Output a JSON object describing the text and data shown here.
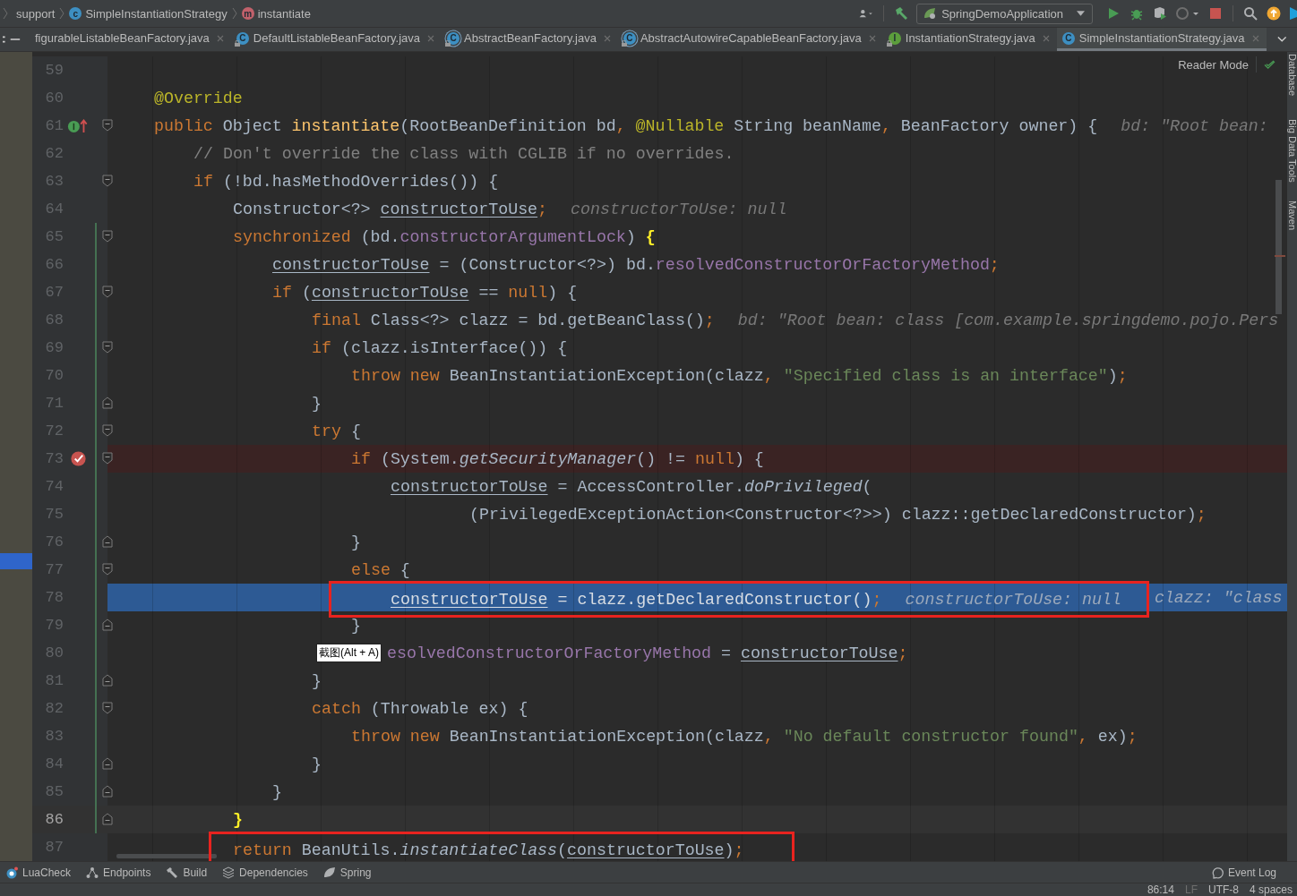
{
  "breadcrumbs": [
    {
      "label": "support"
    },
    {
      "label": "SimpleInstantiationStrategy",
      "badge": "c",
      "kind": "class"
    },
    {
      "label": "instantiate",
      "badge": "m",
      "kind": "method"
    }
  ],
  "run_config": {
    "label": "SpringDemoApplication"
  },
  "tabs": [
    {
      "label": "figurableListableBeanFactory.java",
      "locked": false,
      "selected": false
    },
    {
      "label": "DefaultListableBeanFactory.java",
      "badge": "C",
      "kind": "class",
      "locked": true,
      "selected": false
    },
    {
      "label": "AbstractBeanFactory.java",
      "badge": "C",
      "kind": "abstract",
      "locked": true,
      "selected": false
    },
    {
      "label": "AbstractAutowireCapableBeanFactory.java",
      "badge": "C",
      "kind": "abstract",
      "locked": true,
      "selected": false
    },
    {
      "label": "InstantiationStrategy.java",
      "badge": "I",
      "kind": "interface",
      "locked": true,
      "selected": false
    },
    {
      "label": "SimpleInstantiationStrategy.java",
      "badge": "C",
      "kind": "class",
      "locked": false,
      "selected": true
    }
  ],
  "editor": {
    "reader_mode": "Reader Mode",
    "lines": [
      {
        "number": "59",
        "kind": "normal",
        "changed": false
      },
      {
        "number": "60",
        "kind": "normal",
        "changed": false,
        "tokens": [
          {
            "kind": "annotation",
            "s": "@Override"
          }
        ]
      },
      {
        "number": "61",
        "kind": "normal",
        "changed": false,
        "marker": {
          "kind": "override"
        },
        "fold": {
          "kind": "start"
        },
        "tokens": [
          {
            "kind": "keyword",
            "s": "public "
          },
          {
            "kind": "plain",
            "s": "Object "
          },
          {
            "kind": "method",
            "s": "instantiate"
          },
          {
            "kind": "plain",
            "s": "(RootBeanDefinition bd"
          },
          {
            "kind": "keyword",
            "s": ", "
          },
          {
            "kind": "annotation",
            "s": "@Nullable"
          },
          {
            "kind": "plain",
            "s": " String beanName"
          },
          {
            "kind": "keyword",
            "s": ", "
          },
          {
            "kind": "plain",
            "s": "BeanFactory owner) {"
          },
          {
            "kind": "hint",
            "s": "bd: \"Root bean:"
          }
        ],
        "children": [
          {
            "number": "62",
            "kind": "normal",
            "changed": false,
            "tokens": [
              {
                "kind": "comment",
                "s": "// Don't override the class with CGLIB if no overrides."
              }
            ]
          },
          {
            "number": "63",
            "kind": "normal",
            "changed": false,
            "fold": {
              "kind": "start"
            },
            "tokens": [
              {
                "kind": "keyword",
                "s": "if "
              },
              {
                "kind": "plain",
                "s": "(!bd.hasMethodOverrides()) {"
              }
            ],
            "children": [
              {
                "number": "64",
                "kind": "normal",
                "changed": false,
                "tokens": [
                  {
                    "kind": "plain",
                    "s": "Constructor<?> "
                  },
                  {
                    "kind": "var",
                    "s": "constructorToUse"
                  },
                  {
                    "kind": "keyword",
                    "s": ";"
                  },
                  {
                    "kind": "hint",
                    "s": "constructorToUse: null"
                  }
                ]
              },
              {
                "number": "65",
                "kind": "normal",
                "changed": true,
                "fold": {
                  "kind": "start"
                },
                "tokens": [
                  {
                    "kind": "keyword",
                    "s": "synchronized "
                  },
                  {
                    "kind": "plain",
                    "s": "(bd."
                  },
                  {
                    "kind": "field",
                    "s": "constructorArgumentLock"
                  },
                  {
                    "kind": "plain",
                    "s": ") "
                  },
                  {
                    "kind": "brace",
                    "s": "{"
                  }
                ],
                "children": [
                  {
                    "number": "66",
                    "kind": "normal",
                    "changed": true,
                    "tokens": [
                      {
                        "kind": "var",
                        "s": "constructorToUse"
                      },
                      {
                        "kind": "plain",
                        "s": " = (Constructor<?>) bd."
                      },
                      {
                        "kind": "field",
                        "s": "resolvedConstructorOrFactoryMethod"
                      },
                      {
                        "kind": "keyword",
                        "s": ";"
                      }
                    ]
                  },
                  {
                    "number": "67",
                    "kind": "normal",
                    "changed": true,
                    "fold": {
                      "kind": "start"
                    },
                    "tokens": [
                      {
                        "kind": "keyword",
                        "s": "if "
                      },
                      {
                        "kind": "plain",
                        "s": "("
                      },
                      {
                        "kind": "var",
                        "s": "constructorToUse"
                      },
                      {
                        "kind": "plain",
                        "s": " == "
                      },
                      {
                        "kind": "keyword",
                        "s": "null"
                      },
                      {
                        "kind": "plain",
                        "s": ") {"
                      }
                    ],
                    "children": [
                      {
                        "number": "68",
                        "kind": "normal",
                        "changed": true,
                        "tokens": [
                          {
                            "kind": "keyword",
                            "s": "final "
                          },
                          {
                            "kind": "plain",
                            "s": "Class<?> clazz = bd.getBeanClass()"
                          },
                          {
                            "kind": "keyword",
                            "s": ";"
                          },
                          {
                            "kind": "hint",
                            "s": "bd: \"Root bean: class [com.example.springdemo.pojo.Pers"
                          }
                        ]
                      },
                      {
                        "number": "69",
                        "kind": "normal",
                        "changed": true,
                        "fold": {
                          "kind": "start"
                        },
                        "tokens": [
                          {
                            "kind": "keyword",
                            "s": "if "
                          },
                          {
                            "kind": "plain",
                            "s": "(clazz.isInterface()) {"
                          }
                        ],
                        "children": [
                          {
                            "number": "70",
                            "kind": "normal",
                            "changed": true,
                            "tokens": [
                              {
                                "kind": "keyword",
                                "s": "throw new "
                              },
                              {
                                "kind": "plain",
                                "s": "BeanInstantiationException(clazz"
                              },
                              {
                                "kind": "keyword",
                                "s": ", "
                              },
                              {
                                "kind": "string",
                                "s": "\"Specified class is an interface\""
                              },
                              {
                                "kind": "plain",
                                "s": ")"
                              },
                              {
                                "kind": "keyword",
                                "s": ";"
                              }
                            ]
                          }
                        ]
                      },
                      {
                        "number": "71",
                        "kind": "normal",
                        "changed": true,
                        "fold": {
                          "kind": "end"
                        },
                        "tokens": [
                          {
                            "kind": "plain",
                            "s": "}"
                          }
                        ]
                      },
                      {
                        "number": "72",
                        "kind": "normal",
                        "changed": true,
                        "fold": {
                          "kind": "start"
                        },
                        "tokens": [
                          {
                            "kind": "keyword",
                            "s": "try "
                          },
                          {
                            "kind": "plain",
                            "s": "{"
                          }
                        ],
                        "children": [
                          {
                            "number": "73",
                            "kind": "breakpoint",
                            "changed": true,
                            "marker": {
                              "kind": "breakpoint"
                            },
                            "fold": {
                              "kind": "start"
                            },
                            "tokens": [
                              {
                                "kind": "keyword",
                                "s": "if "
                              },
                              {
                                "kind": "plain",
                                "s": "(System."
                              },
                              {
                                "kind": "static",
                                "s": "getSecurityManager"
                              },
                              {
                                "kind": "plain",
                                "s": "() != "
                              },
                              {
                                "kind": "keyword",
                                "s": "null"
                              },
                              {
                                "kind": "plain",
                                "s": ") {"
                              }
                            ],
                            "children": [
                              {
                                "number": "74",
                                "kind": "normal",
                                "changed": true,
                                "tokens": [
                                  {
                                    "kind": "var",
                                    "s": "constructorToUse"
                                  },
                                  {
                                    "kind": "plain",
                                    "s": " = AccessController."
                                  },
                                  {
                                    "kind": "static",
                                    "s": "doPrivileged"
                                  },
                                  {
                                    "kind": "plain",
                                    "s": "("
                                  }
                                ],
                                "continuation": [
                                  {
                                    "number": "75",
                                    "kind": "normal",
                                    "changed": true,
                                    "tokens": [
                                      {
                                        "kind": "plain",
                                        "s": "(PrivilegedExceptionAction<Constructor<?>>) clazz::getDeclaredConstructor)"
                                      },
                                      {
                                        "kind": "keyword",
                                        "s": ";"
                                      }
                                    ]
                                  }
                                ]
                              }
                            ]
                          },
                          {
                            "number": "76",
                            "kind": "normal",
                            "changed": true,
                            "fold": {
                              "kind": "end"
                            },
                            "tokens": [
                              {
                                "kind": "plain",
                                "s": "}"
                              }
                            ]
                          },
                          {
                            "number": "77",
                            "kind": "normal",
                            "changed": true,
                            "fold": {
                              "kind": "start"
                            },
                            "tokens": [
                              {
                                "kind": "keyword",
                                "s": "else "
                              },
                              {
                                "kind": "plain",
                                "s": "{"
                              }
                            ],
                            "children": [
                              {
                                "number": "78",
                                "kind": "execution",
                                "changed": true,
                                "tokens": [
                                  {
                                    "kind": "box",
                                    "tokens": [
                                      {
                                        "kind": "var",
                                        "s": "constructorToUse"
                                      },
                                      {
                                        "kind": "plain",
                                        "s": " = clazz.getDeclaredConstructor()"
                                      },
                                      {
                                        "kind": "keyword",
                                        "s": ";"
                                      },
                                      {
                                        "kind": "hint",
                                        "s": "constructorToUse: null"
                                      }
                                    ]
                                  },
                                  {
                                    "kind": "hint",
                                    "s": "clazz: \"class"
                                  }
                                ]
                              }
                            ]
                          },
                          {
                            "number": "79",
                            "kind": "normal",
                            "changed": true,
                            "fold": {
                              "kind": "end"
                            },
                            "tokens": [
                              {
                                "kind": "plain",
                                "s": "}"
                              }
                            ]
                          },
                          {
                            "number": "80",
                            "kind": "normal",
                            "changed": true,
                            "tokens": [
                              {
                                "kind": "tooltip",
                                "s": "截图(Alt + A)"
                              },
                              {
                                "kind": "field",
                                "s": "esolvedConstructorOrFactoryMethod"
                              },
                              {
                                "kind": "plain",
                                "s": " = "
                              },
                              {
                                "kind": "var",
                                "s": "constructorToUse"
                              },
                              {
                                "kind": "keyword",
                                "s": ";"
                              }
                            ]
                          }
                        ]
                      },
                      {
                        "number": "81",
                        "kind": "normal",
                        "changed": true,
                        "fold": {
                          "kind": "end"
                        },
                        "tokens": [
                          {
                            "kind": "plain",
                            "s": "}"
                          }
                        ]
                      },
                      {
                        "number": "82",
                        "kind": "normal",
                        "changed": true,
                        "fold": {
                          "kind": "start"
                        },
                        "tokens": [
                          {
                            "kind": "keyword",
                            "s": "catch "
                          },
                          {
                            "kind": "plain",
                            "s": "(Throwable ex) {"
                          }
                        ],
                        "children": [
                          {
                            "number": "83",
                            "kind": "normal",
                            "changed": true,
                            "tokens": [
                              {
                                "kind": "keyword",
                                "s": "throw new "
                              },
                              {
                                "kind": "plain",
                                "s": "BeanInstantiationException(clazz"
                              },
                              {
                                "kind": "keyword",
                                "s": ", "
                              },
                              {
                                "kind": "string",
                                "s": "\"No default constructor found\""
                              },
                              {
                                "kind": "keyword",
                                "s": ", "
                              },
                              {
                                "kind": "plain",
                                "s": "ex)"
                              },
                              {
                                "kind": "keyword",
                                "s": ";"
                              }
                            ]
                          }
                        ]
                      },
                      {
                        "number": "84",
                        "kind": "normal",
                        "changed": true,
                        "fold": {
                          "kind": "end"
                        },
                        "tokens": [
                          {
                            "kind": "plain",
                            "s": "}"
                          }
                        ]
                      }
                    ]
                  },
                  {
                    "number": "85",
                    "kind": "normal",
                    "changed": true,
                    "fold": {
                      "kind": "end"
                    },
                    "tokens": [
                      {
                        "kind": "plain",
                        "s": "}"
                      }
                    ]
                  }
                ]
              },
              {
                "number": "86",
                "kind": "caret",
                "changed": true,
                "fold": {
                  "kind": "end"
                },
                "tokens": [
                  {
                    "kind": "brace",
                    "s": "}"
                  }
                ]
              },
              {
                "number": "87",
                "kind": "normal",
                "changed": false,
                "tokens": [
                  {
                    "kind": "box",
                    "tokens": [
                      {
                        "kind": "keyword",
                        "s": "return "
                      },
                      {
                        "kind": "plain",
                        "s": "BeanUtils."
                      },
                      {
                        "kind": "static",
                        "s": "instantiateClass"
                      },
                      {
                        "kind": "plain",
                        "s": "("
                      },
                      {
                        "kind": "var",
                        "s": "constructorToUse"
                      },
                      {
                        "kind": "plain",
                        "s": ")"
                      },
                      {
                        "kind": "keyword",
                        "s": ";"
                      }
                    ]
                  }
                ]
              }
            ]
          }
        ]
      }
    ]
  },
  "right_strip": [
    "Database",
    "Big Data Tools",
    "Maven"
  ],
  "tool_windows": [
    "LuaCheck",
    "Endpoints",
    "Build",
    "Dependencies",
    "Spring"
  ],
  "event_log": "Event Log",
  "status_bar": [
    {
      "text": "86:14",
      "dim": false
    },
    {
      "text": "LF",
      "dim": true
    },
    {
      "text": "UTF-8",
      "dim": false
    },
    {
      "text": "4 spaces",
      "dim": false
    }
  ]
}
